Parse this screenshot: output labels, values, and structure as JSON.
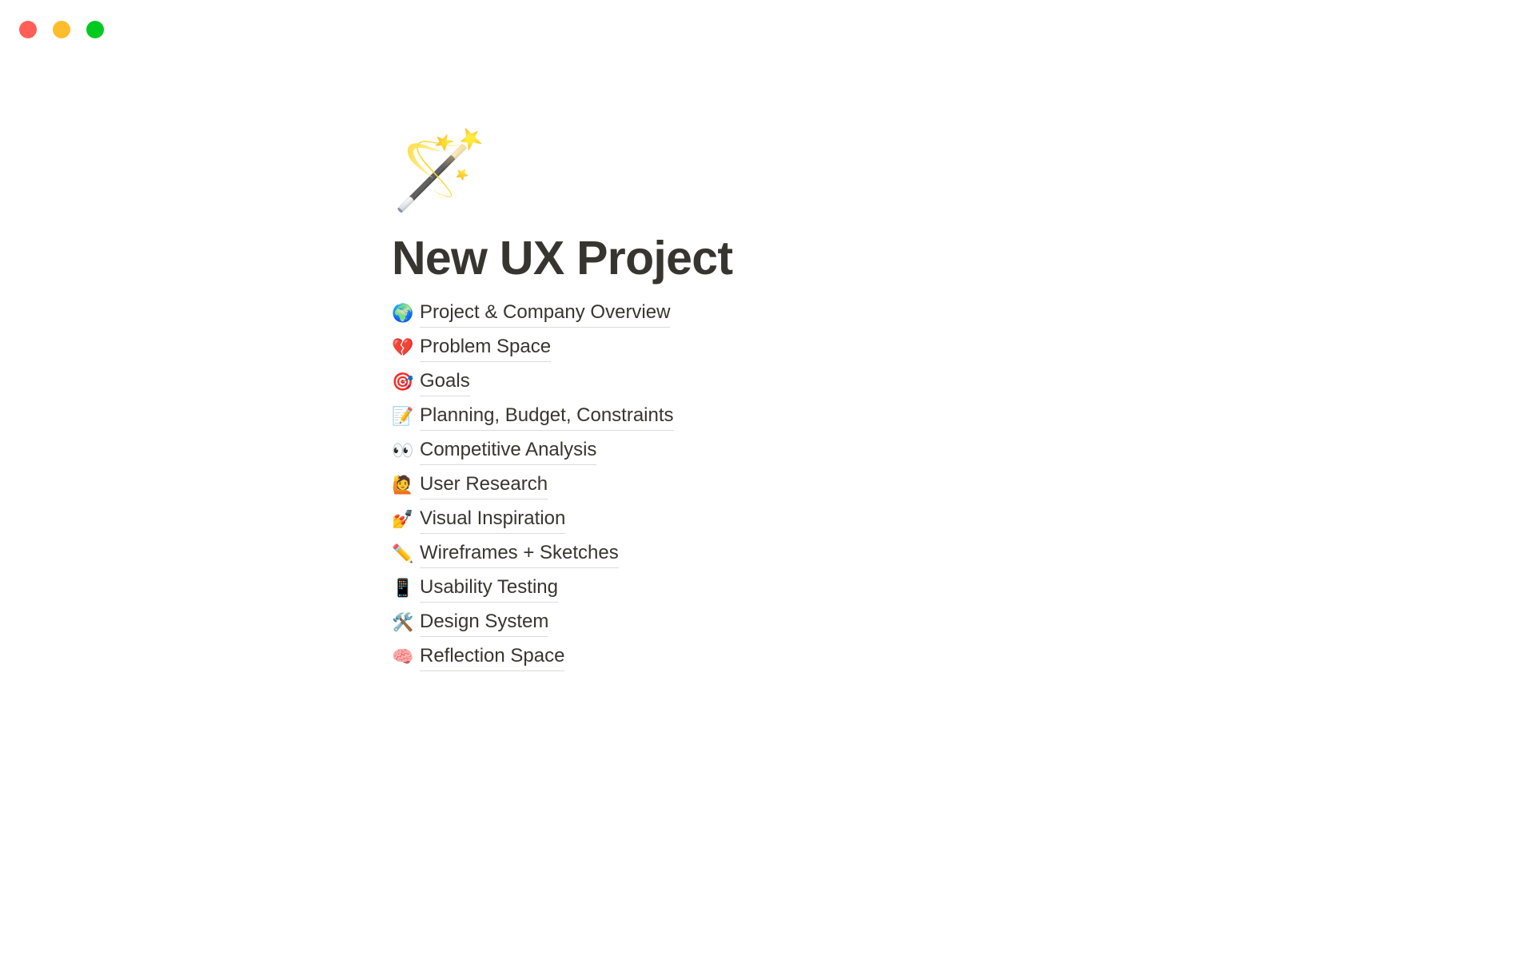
{
  "window": {
    "traffic_lights": [
      {
        "name": "close-button",
        "label": "Close",
        "color": "#ff5f57"
      },
      {
        "name": "minimize-button",
        "label": "Minimize",
        "color": "#ffbd2e"
      },
      {
        "name": "maximize-button",
        "label": "Maximize",
        "color": "#00ca1f"
      }
    ],
    "background": "#ffffff"
  },
  "page": {
    "icon": "🪄",
    "icon_name": "magic-wand-icon",
    "title": "New UX Project",
    "text_color": "#37352f",
    "divider_color": "#dcdbd9",
    "links": [
      {
        "emoji": "🌍",
        "icon_name": "globe-showing-europe-africa-icon",
        "label": "Project & Company Overview"
      },
      {
        "emoji": "💔",
        "icon_name": "broken-heart-icon",
        "label": "Problem Space"
      },
      {
        "emoji": "🎯",
        "icon_name": "bullseye-dart-icon",
        "label": "Goals"
      },
      {
        "emoji": "📝",
        "icon_name": "memo-notepad-icon",
        "label": "Planning, Budget, Constraints"
      },
      {
        "emoji": "👀",
        "icon_name": "eyes-icon",
        "label": "Competitive Analysis"
      },
      {
        "emoji": "🙋",
        "icon_name": "person-raising-hand-icon",
        "label": "User Research"
      },
      {
        "emoji": "💅",
        "icon_name": "nail-polish-icon",
        "label": "Visual Inspiration"
      },
      {
        "emoji": "✏️",
        "icon_name": "pencil-icon",
        "label": "Wireframes + Sketches"
      },
      {
        "emoji": "📱",
        "icon_name": "mobile-phone-icon",
        "label": "Usability Testing"
      },
      {
        "emoji": "🛠️",
        "icon_name": "hammer-and-wrench-icon",
        "label": "Design System"
      },
      {
        "emoji": "🧠",
        "icon_name": "brain-icon",
        "label": "Reflection Space"
      }
    ]
  }
}
